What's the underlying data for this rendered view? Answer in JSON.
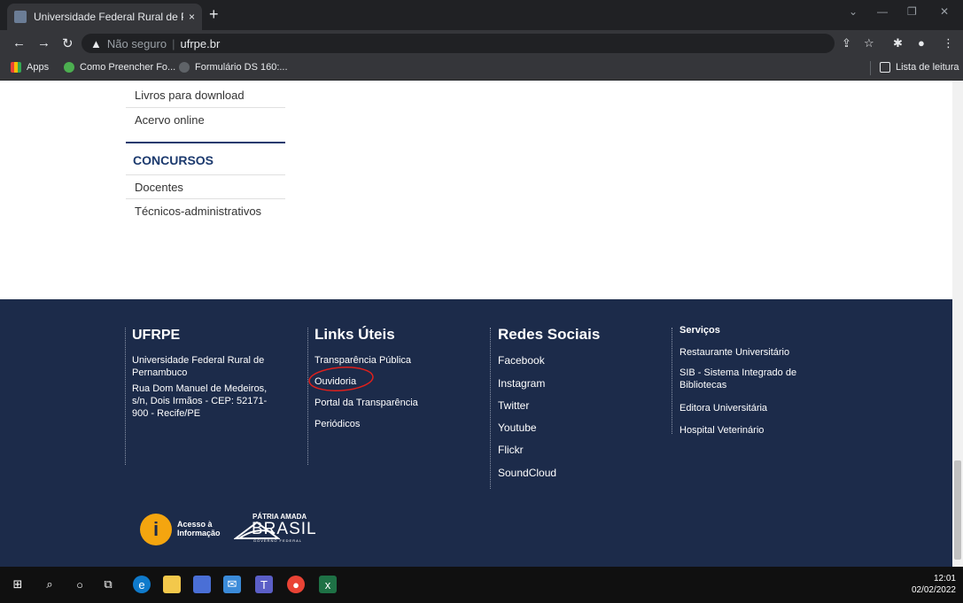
{
  "browser": {
    "tab_title": "Universidade Federal Rural de Pe",
    "tab_close": "×",
    "new_tab": "+",
    "security_label": "Não seguro",
    "url": "ufrpe.br",
    "bookmarks": [
      {
        "label": "Apps"
      },
      {
        "label": "Como Preencher Fo..."
      },
      {
        "label": "Formulário DS 160:..."
      }
    ],
    "reading_list": "Lista de leitura"
  },
  "sidebar": {
    "library_links": [
      "Livros para download",
      "Acervo online"
    ],
    "concursos_heading": "CONCURSOS",
    "concursos_links": [
      "Docentes",
      "Técnicos-administrativos"
    ]
  },
  "footer": {
    "ufrpe": {
      "heading": "UFRPE",
      "name": "Universidade Federal Rural de Pernambuco",
      "address": "Rua Dom Manuel de Medeiros, s/n, Dois Irmãos - CEP: 52171-900 - Recife/PE"
    },
    "links_uteis": {
      "heading": "Links Úteis",
      "items": [
        "Transparência Pública",
        "Ouvidoria",
        "Portal da Transparência",
        "Periódicos"
      ]
    },
    "redes_sociais": {
      "heading": "Redes Sociais",
      "items": [
        "Facebook",
        "Instagram",
        "Twitter",
        "Youtube",
        "Flickr",
        "SoundCloud"
      ]
    },
    "servicos": {
      "heading": "Serviços",
      "items": [
        "Restaurante Universitário",
        "SIB - Sistema Integrado de Bibliotecas",
        "Editora Universitária",
        "Hospital Veterinário"
      ]
    },
    "logos": {
      "acesso_line1": "Acesso à",
      "acesso_line2": "Informação",
      "patria": "PÁTRIA AMADA",
      "brasil": "BRASIL",
      "governo": "GOVERNO FEDERAL"
    }
  },
  "taskbar": {
    "time": "12:01",
    "date": "02/02/2022"
  }
}
